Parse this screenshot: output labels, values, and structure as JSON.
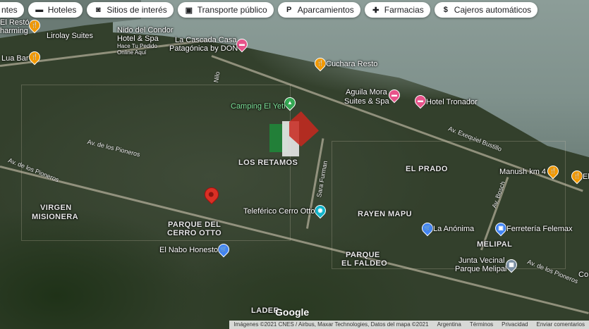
{
  "chips": [
    {
      "label": "ntes",
      "icon": ""
    },
    {
      "label": "Hoteles",
      "icon": "bed-icon"
    },
    {
      "label": "Sitios de interés",
      "icon": "camera-icon"
    },
    {
      "label": "Transporte público",
      "icon": "bus-icon"
    },
    {
      "label": "Aparcamientos",
      "icon": "parking-icon"
    },
    {
      "label": "Farmacias",
      "icon": "pharmacy-icon"
    },
    {
      "label": "Cajeros automáticos",
      "icon": "atm-icon"
    }
  ],
  "places": {
    "el_resto": "El Restó",
    "charming": "harming",
    "lirolay": "Lirolay Suites",
    "lua_bar": "Lua Bar",
    "nido_1": "Nido del Condor",
    "nido_2": "Hotel & Spa",
    "nido_3": "Hace Tu Pedido",
    "nido_4": "Online Aquí",
    "cascada_1": "La Cascada Casa",
    "cascada_2": "Patagónica by DON",
    "cuchara": "Cuchara Resto",
    "aguila_1": "Aguila Mora",
    "aguila_2": "Suites & Spa",
    "tronador": "Hotel Tronador",
    "camping": "Camping El Yeti",
    "manush": "Manush km 4",
    "el": "El",
    "teleferico": "Teleférico Cerro Otto",
    "anonima": "La Anónima",
    "ferreteria": "Ferretería Felemax",
    "nabo": "El Nabo Honesto",
    "junta_1": "Junta Vecinal",
    "junta_2": "Parque Melipal",
    "co": "Co"
  },
  "areas": {
    "los_retamos": "LOS RETAMOS",
    "el_prado": "EL PRADO",
    "rayen_mapu": "RAYEN MAPU",
    "virgen_1": "VIRGEN",
    "virgen_2": "MISIONERA",
    "parque_cerro_1": "PARQUE DEL",
    "parque_cerro_2": "CERRO OTTO",
    "melipal": "MELIPAL",
    "parque_faldeo_1": "PARQUE",
    "parque_faldeo_2": "EL FALDEO",
    "lader": "LADER"
  },
  "streets": {
    "pioneros_1": "Av. de los Pioneros",
    "pioneros_2": "Av. de los Pioneros",
    "pioneros_3": "Av. de los Pioneros",
    "bustillo": "Av. Exequiel Bustillo",
    "furman": "Sara Furman",
    "bosch": "Av. Bosch",
    "nilo": "Nilo"
  },
  "branding": {
    "google": "Google"
  },
  "footer": {
    "attribution": "Imágenes ©2021 CNES / Airbus, Maxar Technologies, Datos del mapa ©2021",
    "country": "Argentina",
    "terms": "Términos",
    "privacy": "Privacidad",
    "feedback": "Enviar comentarios"
  },
  "colors": {
    "food_pin": "#f29900",
    "hotel_pin": "#e7538a",
    "shop_pin": "#4285f4",
    "park_pin": "#34a853",
    "transit_pin": "#12b5cb",
    "selected_pin": "#d93025"
  }
}
